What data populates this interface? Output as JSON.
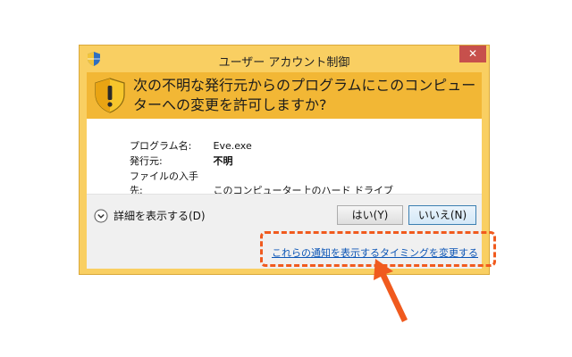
{
  "dialog": {
    "title": "ユーザー アカウント制御",
    "close_symbol": "✕",
    "question": "次の不明な発行元からのプログラムにこのコンピューターへの変更を許可しますか?",
    "info": [
      {
        "label": "プログラム名:",
        "value": "Eve.exe"
      },
      {
        "label": "発行元:",
        "value": "不明"
      },
      {
        "label": "ファイルの入手先:",
        "value": "このコンピューター上のハード ドライブ"
      }
    ],
    "details_label": "詳細を表示する(D)",
    "yes_label": "はい(Y)",
    "no_label": "いいえ(N)",
    "footer_link": "これらの通知を表示するタイミングを変更する"
  },
  "colors": {
    "frame": "#f9cf62",
    "header": "#f2b735",
    "close": "#c7504c",
    "link": "#0b55b6",
    "highlight": "#f05a1e"
  },
  "icons": {
    "title": "uac-shield-icon",
    "warning": "warning-shield-icon",
    "details": "chevron-down-icon",
    "annotation": "arrow-icon"
  }
}
